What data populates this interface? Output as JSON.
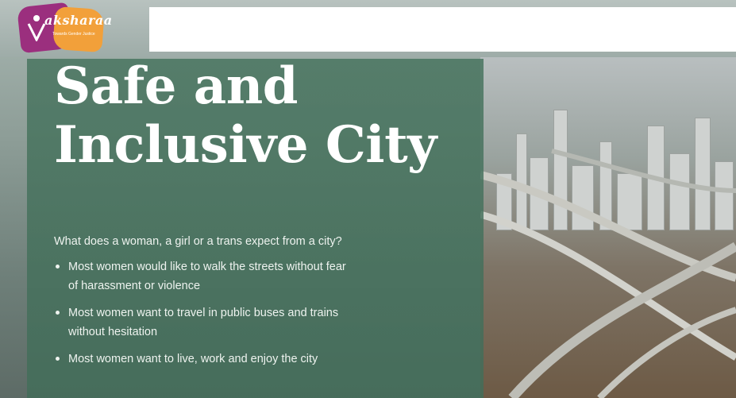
{
  "header": {
    "logo": {
      "icon": "aksharaa-logo-icon",
      "brand_text": "aksharaa",
      "tagline": "Towards Gender Justice",
      "colors": {
        "primary": "#9b2f7e",
        "secondary": "#f2a03a"
      }
    },
    "address_bar_value": ""
  },
  "slide": {
    "title_line1": "Safe and",
    "title_line2": "Inclusive City",
    "question": "What does a woman, a girl or a trans expect from a city?",
    "bullets": [
      {
        "line1": "Most women would like to walk the streets without fear",
        "line2": "of harassment or violence"
      },
      {
        "line1": "Most women want to travel in public buses and trains",
        "line2": "without hesitation"
      },
      {
        "line1": "Most women want to live, work and enjoy the city",
        "line2": ""
      }
    ],
    "panel_color": "#44705c"
  }
}
